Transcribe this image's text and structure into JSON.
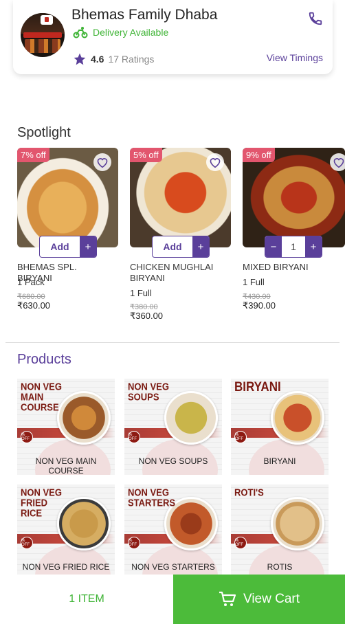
{
  "restaurant": {
    "name": "Bhemas Family Dhaba",
    "delivery": "Delivery Available",
    "rating": "4.6",
    "ratings_count": "17 Ratings",
    "view_timings": "View Timings"
  },
  "spotlight": {
    "title": "Spotlight",
    "items": [
      {
        "discount": "7% off",
        "name": "BHEMAS SPL. BIRYANI",
        "qty": "1 Pack",
        "old_price": "₹680.00",
        "price": "₹630.00",
        "action": "Add",
        "plus": "+"
      },
      {
        "discount": "5% off",
        "name": "CHICKEN MUGHLAI BIRYANI",
        "qty": "1 Full",
        "old_price": "₹380.00",
        "price": "₹360.00",
        "action": "Add",
        "plus": "+"
      },
      {
        "discount": "9% off",
        "name": "MIXED BIRYANI",
        "qty": "1 Full",
        "old_price": "₹430.00",
        "price": "₹390.00",
        "minus": "−",
        "count": "1",
        "plus": "+"
      }
    ]
  },
  "products": {
    "title": "Products",
    "tiles": [
      {
        "heading": "NON VEG MAIN COURSE",
        "label": "NON VEG MAIN COURSE"
      },
      {
        "heading": "NON VEG SOUPS",
        "label": "NON VEG SOUPS"
      },
      {
        "heading": "BIRYANI",
        "label": "BIRYANI"
      },
      {
        "heading": "NON VEG FRIED RICE",
        "label": "NON VEG FRIED RICE"
      },
      {
        "heading": "NON VEG STARTERS",
        "label": "NON VEG STARTERS"
      },
      {
        "heading": "ROTI'S",
        "label": "ROTIS"
      }
    ],
    "off_seal": "% OFF"
  },
  "bottom_bar": {
    "items": "1 ITEM",
    "view_cart": "View Cart"
  },
  "colors": {
    "accent": "#5a3f9a",
    "green": "#3fb436",
    "cart_green": "#4cbb3a",
    "discount": "#e2566e"
  }
}
